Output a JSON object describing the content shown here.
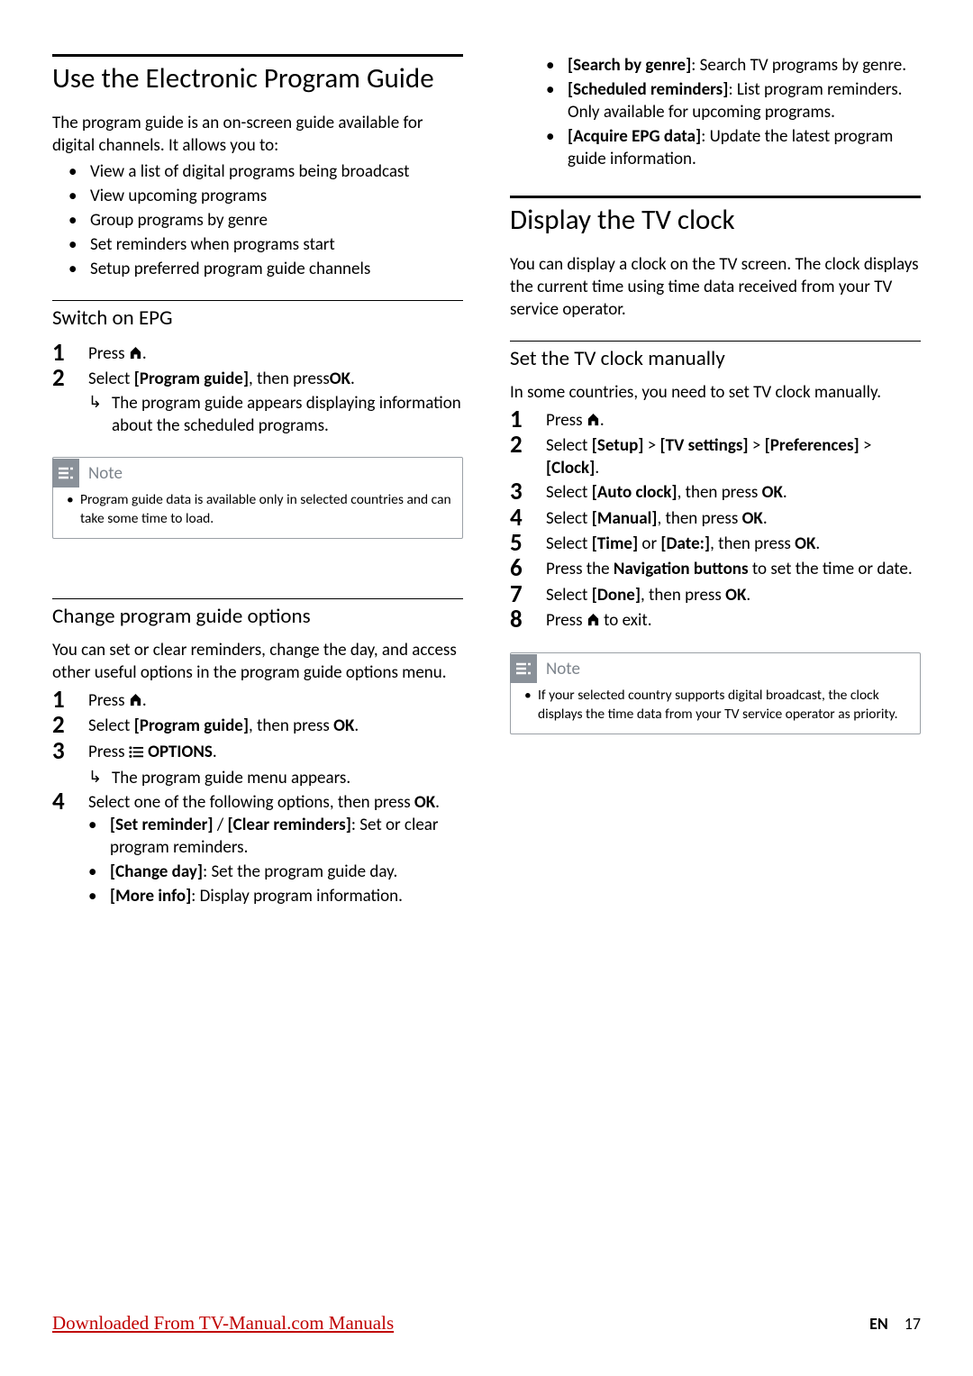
{
  "left": {
    "h1": "Use the Electronic Program Guide",
    "intro": "The program guide is an on-screen guide available for digital channels. It allows you to:",
    "intro_items": [
      "View a list of digital programs being broadcast",
      "View upcoming programs",
      "Group programs by genre",
      "Set reminders when programs start",
      "Setup preferred program guide channels"
    ],
    "sec1_h2": "Switch on EPG",
    "sec1_step1": "Press ",
    "sec1_step2_a": "Select ",
    "sec1_step2_b": "[Program guide]",
    "sec1_step2_c": ", then press",
    "sec1_step2_d": "OK",
    "sec1_step2_e": ".",
    "sec1_result": "The program guide appears displaying information about the scheduled programs.",
    "note1_label": "Note",
    "note1_text": "Program guide data is available only in selected countries and can take some time to load.",
    "sec2_h2": "Change program guide options",
    "sec2_intro": "You can set or clear reminders, change the day, and access other useful options in the program guide options menu.",
    "sec2_step1": "Press ",
    "sec2_step2_a": "Select ",
    "sec2_step2_b": "[Program guide]",
    "sec2_step2_c": ", then press ",
    "sec2_step2_d": "OK",
    "sec2_step2_e": ".",
    "sec2_step3_a": "Press ",
    "sec2_step3_b": " OPTIONS",
    "sec2_step3_c": ".",
    "sec2_result": "The program guide menu appears.",
    "sec2_step4_a": "Select one of the following options, then press ",
    "sec2_step4_b": "OK",
    "sec2_step4_c": ".",
    "opt1_b": "[Set reminder]",
    "opt1_mid": " / ",
    "opt1_b2": "[Clear reminders]",
    "opt1_t": ": Set or clear program reminders.",
    "opt2_b": "[Change day]",
    "opt2_t": ": Set the program guide day.",
    "opt3_b": "[More info]",
    "opt3_t": ": Display program information."
  },
  "right": {
    "opt4_b": "[Search by genre]",
    "opt4_t": ": Search TV programs by genre.",
    "opt5_b": "[Scheduled reminders]",
    "opt5_t": ": List program reminders. Only available for upcoming programs.",
    "opt6_b": "[Acquire EPG data]",
    "opt6_t": ": Update the latest program guide information.",
    "h1b": "Display the TV clock",
    "introb": "You can display a clock on the TV screen. The clock displays the current time using time data received from your TV service operator.",
    "sec3_h2": "Set the TV clock manually",
    "sec3_intro": "In some countries, you need to set TV clock manually.",
    "s1": "Press ",
    "s2a": "Select ",
    "s2b": "[Setup]",
    "s2c": " > ",
    "s2d": "[TV settings]",
    "s2e": " > ",
    "s2f": "[Preferences]",
    "s2g": " > ",
    "s2h": "[Clock]",
    "s2i": ".",
    "s3a": "Select ",
    "s3b": "[Auto clock]",
    "s3c": ", then press ",
    "s3d": "OK",
    "s3e": ".",
    "s4a": "Select ",
    "s4b": "[Manual]",
    "s4c": ", then press ",
    "s4d": "OK",
    "s4e": ".",
    "s5a": "Select ",
    "s5b": "[Time]",
    "s5c": " or ",
    "s5d": "[Date:]",
    "s5e": ", then press ",
    "s5f": "OK",
    "s5g": ".",
    "s6a": "Press the ",
    "s6b": "Navigation buttons",
    "s6c": " to set the time or date.",
    "s7a": "Select ",
    "s7b": "[Done]",
    "s7c": ", then press ",
    "s7d": "OK",
    "s7e": ".",
    "s8a": "Press ",
    "s8b": " to exit.",
    "note2_label": "Note",
    "note2_text": "If your selected country supports digital broadcast, the clock displays the time data from your TV service operator as priority."
  },
  "footer": {
    "link": "Downloaded From TV-Manual.com Manuals",
    "lang": "EN",
    "page": "17"
  }
}
